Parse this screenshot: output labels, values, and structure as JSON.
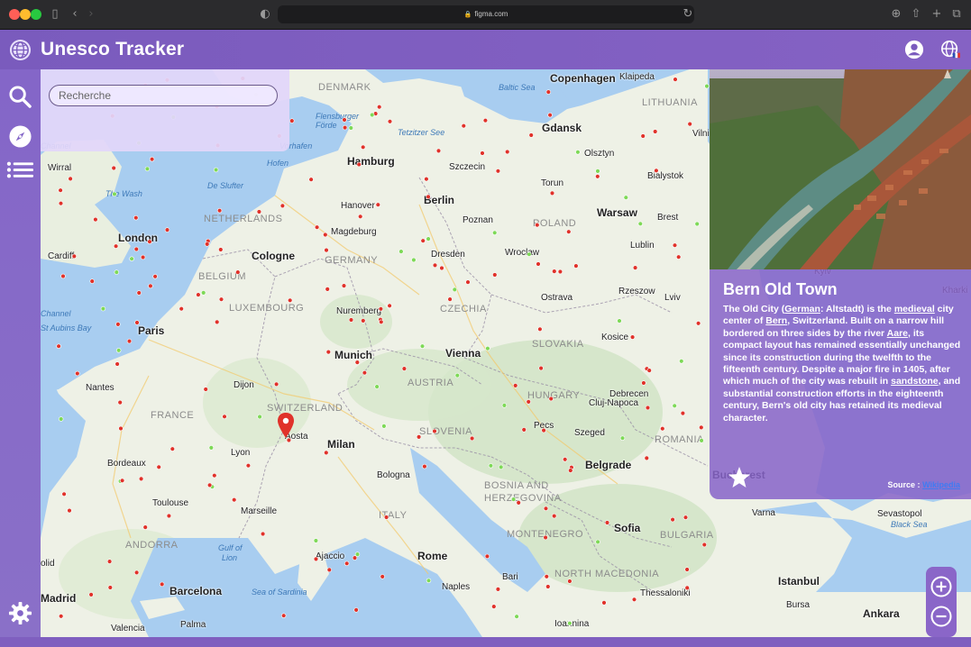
{
  "browser": {
    "url": "figma.com"
  },
  "app": {
    "title": "Unesco Tracker"
  },
  "search": {
    "placeholder": "Recherche"
  },
  "map": {
    "cities": [
      {
        "name": "Copenhagen",
        "cls": ""
      },
      {
        "name": "Klaipeda",
        "cls": "small"
      },
      {
        "name": "Gdansk",
        "cls": ""
      },
      {
        "name": "Olsztyn",
        "cls": "small"
      },
      {
        "name": "Hamburg",
        "cls": ""
      },
      {
        "name": "Szczecin",
        "cls": "small"
      },
      {
        "name": "Bialystok",
        "cls": "small"
      },
      {
        "name": "Torun",
        "cls": "small"
      },
      {
        "name": "Berlin",
        "cls": ""
      },
      {
        "name": "Hanover",
        "cls": "small"
      },
      {
        "name": "Poznan",
        "cls": "small"
      },
      {
        "name": "Warsaw",
        "cls": ""
      },
      {
        "name": "Brest",
        "cls": "small"
      },
      {
        "name": "Wirral",
        "cls": "small"
      },
      {
        "name": "London",
        "cls": ""
      },
      {
        "name": "Magdeburg",
        "cls": "small"
      },
      {
        "name": "Cardiff",
        "cls": "small"
      },
      {
        "name": "Cologne",
        "cls": ""
      },
      {
        "name": "Dresden",
        "cls": "small"
      },
      {
        "name": "Wroclaw",
        "cls": "small"
      },
      {
        "name": "Lublin",
        "cls": "small"
      },
      {
        "name": "Kyiv",
        "cls": "small"
      },
      {
        "name": "Ostrava",
        "cls": "small"
      },
      {
        "name": "Rzeszow",
        "cls": "small"
      },
      {
        "name": "Lviv",
        "cls": "small"
      },
      {
        "name": "Nuremberg",
        "cls": "small"
      },
      {
        "name": "Paris",
        "cls": ""
      },
      {
        "name": "Munich",
        "cls": ""
      },
      {
        "name": "Vienna",
        "cls": ""
      },
      {
        "name": "Kosice",
        "cls": "small"
      },
      {
        "name": "Nantes",
        "cls": "small"
      },
      {
        "name": "Dijon",
        "cls": "small"
      },
      {
        "name": "Debrecen",
        "cls": "small"
      },
      {
        "name": "Cluj-Napoca",
        "cls": "small"
      },
      {
        "name": "Aosta",
        "cls": "small"
      },
      {
        "name": "Milan",
        "cls": ""
      },
      {
        "name": "Pecs",
        "cls": "small"
      },
      {
        "name": "Szeged",
        "cls": "small"
      },
      {
        "name": "Lyon",
        "cls": "small"
      },
      {
        "name": "Bordeaux",
        "cls": "small"
      },
      {
        "name": "Bologna",
        "cls": "small"
      },
      {
        "name": "Belgrade",
        "cls": ""
      },
      {
        "name": "Bucharest",
        "cls": ""
      },
      {
        "name": "Toulouse",
        "cls": "small"
      },
      {
        "name": "Marseille",
        "cls": "small"
      },
      {
        "name": "Varna",
        "cls": "small"
      },
      {
        "name": "Sevastopol",
        "cls": "small"
      },
      {
        "name": "Sofia",
        "cls": ""
      },
      {
        "name": "Ajaccio",
        "cls": "small"
      },
      {
        "name": "Rome",
        "cls": ""
      },
      {
        "name": "Bari",
        "cls": "small"
      },
      {
        "name": "Barcelona",
        "cls": ""
      },
      {
        "name": "Naples",
        "cls": "small"
      },
      {
        "name": "Thessaloniki",
        "cls": "small"
      },
      {
        "name": "Istanbul",
        "cls": ""
      },
      {
        "name": "Madrid",
        "cls": ""
      },
      {
        "name": "Bursa",
        "cls": "small"
      },
      {
        "name": "Ankara",
        "cls": ""
      },
      {
        "name": "Palma",
        "cls": "small"
      },
      {
        "name": "Valencia",
        "cls": "small"
      },
      {
        "name": "Ioannina",
        "cls": "small"
      },
      {
        "name": "Kharki",
        "cls": "small"
      },
      {
        "name": "Vilni",
        "cls": "small"
      },
      {
        "name": "olid",
        "cls": "small"
      }
    ],
    "countries": [
      "DENMARK",
      "LITHUANIA",
      "NETHERLANDS",
      "GERMANY",
      "POLAND",
      "BELGIUM",
      "LUXEMBOURG",
      "CZECHIA",
      "SLOVAKIA",
      "FRANCE",
      "AUSTRIA",
      "SWITZERLAND",
      "HUNGARY",
      "SLOVENIA",
      "ROMANIA",
      "BOSNIA AND",
      "HERZEGOVINA",
      "ITALY",
      "MONTENEGRO",
      "BULGARIA",
      "ANDORRA",
      "NORTH MACEDONIA"
    ],
    "seas": [
      "Baltic Sea",
      "Flensburger",
      "Förde",
      "Tetzitzer See",
      "Vorhafen",
      "Hofen",
      "The Wash",
      "De Slufter",
      "Channel",
      "Channel",
      "St Aubins Bay",
      "Gulf of",
      "Lion",
      "Sea of Sardinia",
      "Black Sea"
    ]
  },
  "info": {
    "title": "Bern Old Town",
    "desc": {
      "t1": "The Old City (",
      "l1": "German",
      "t2": ": Altstadt) is the ",
      "l2": "medieval",
      "t3": " city center of ",
      "l3": "Bern",
      "t4": ", Switzerland. Built on a narrow hill bordered on three sides by the river ",
      "l4": "Aare",
      "t5": ", its compact layout has remained essentially unchanged since its construction during the twelfth to the fifteenth century. Despite a major fire in 1405, after which much of the city was rebuilt in ",
      "l5": "sandstone",
      "t6": ", and substantial construction efforts in the eighteenth century, Bern's old city has retained its medieval character."
    },
    "source_label": "Source :",
    "source_link": "Wikipedia"
  },
  "colors": {
    "accent": "#7f5fbf",
    "panel": "#8764c8",
    "search_bg": "#e2d6fa",
    "marker_red": "#e0322a",
    "marker_green": "#7ed957",
    "link": "#3f7bf2"
  },
  "icons": {
    "logo": "globe-logo-icon",
    "account": "account-icon",
    "language": "globe-language-icon",
    "search": "search-icon",
    "explore": "compass-icon",
    "list": "list-icon",
    "settings": "gear-icon",
    "favorite": "star-icon",
    "zoom_in": "zoom-in-icon",
    "zoom_out": "zoom-out-icon",
    "selected_marker": "map-pin-icon"
  }
}
